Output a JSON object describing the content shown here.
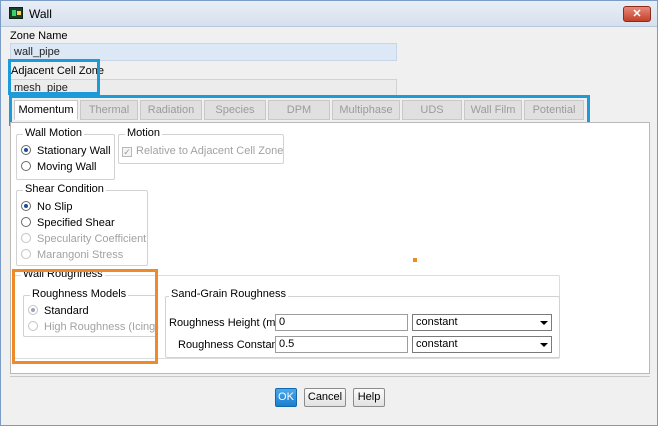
{
  "window": {
    "title": "Wall",
    "close_label": "✕"
  },
  "zone": {
    "name_label": "Zone Name",
    "name_value": "wall_pipe"
  },
  "adjacent": {
    "label": "Adjacent Cell Zone",
    "value": "mesh_pipe"
  },
  "tabs": [
    {
      "label": "Momentum",
      "active": true
    },
    {
      "label": "Thermal",
      "active": false
    },
    {
      "label": "Radiation",
      "active": false
    },
    {
      "label": "Species",
      "active": false
    },
    {
      "label": "DPM",
      "active": false
    },
    {
      "label": "Multiphase",
      "active": false
    },
    {
      "label": "UDS",
      "active": false
    },
    {
      "label": "Wall Film",
      "active": false
    },
    {
      "label": "Potential",
      "active": false
    }
  ],
  "wall_motion": {
    "title": "Wall Motion",
    "options": [
      {
        "label": "Stationary Wall",
        "selected": true
      },
      {
        "label": "Moving Wall",
        "selected": false
      }
    ]
  },
  "motion": {
    "title": "Motion",
    "checkbox_label": "Relative to Adjacent Cell Zone",
    "checked": true
  },
  "shear": {
    "title": "Shear Condition",
    "options": [
      {
        "label": "No Slip",
        "selected": true,
        "disabled": false
      },
      {
        "label": "Specified Shear",
        "selected": false,
        "disabled": false
      },
      {
        "label": "Specularity Coefficient",
        "selected": false,
        "disabled": true
      },
      {
        "label": "Marangoni Stress",
        "selected": false,
        "disabled": true
      }
    ]
  },
  "roughness": {
    "title": "Wall Roughness",
    "models_title": "Roughness Models",
    "models": [
      {
        "label": "Standard",
        "selected": true,
        "disabled": false
      },
      {
        "label": "High Roughness (Icing)",
        "selected": false,
        "disabled": true
      }
    ],
    "sand_grain_title": "Sand-Grain Roughness",
    "height_label": "Roughness Height (m)",
    "height_value": "0",
    "height_method": "constant",
    "constant_label": "Roughness Constant",
    "constant_value": "0.5",
    "constant_method": "constant"
  },
  "buttons": {
    "ok": "OK",
    "cancel": "Cancel",
    "help": "Help"
  },
  "colors": {
    "highlight_blue": "#1e9ad8",
    "highlight_orange": "#ef8a2a",
    "primary_button": "#1b7fd0"
  }
}
